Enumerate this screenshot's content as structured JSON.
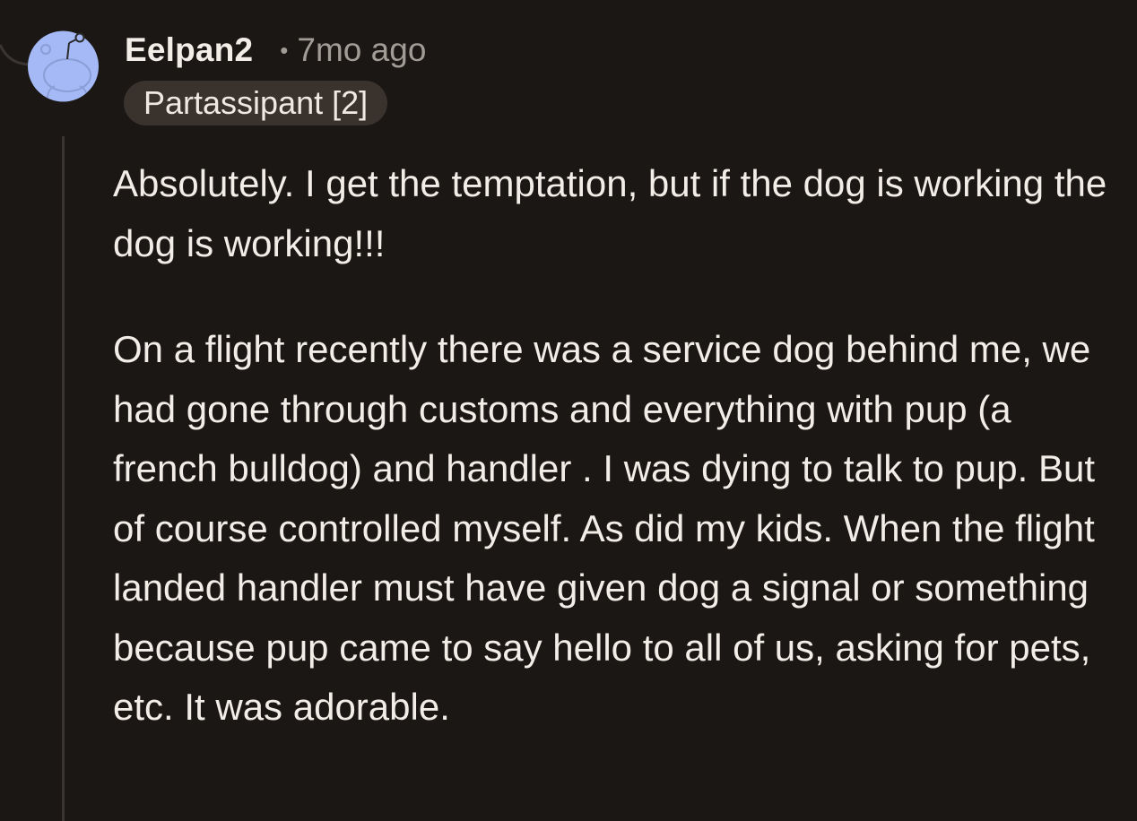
{
  "comment": {
    "username": "Eelpan2",
    "separator": "•",
    "timestamp": "7mo ago",
    "flair": "Partassipant [2]",
    "avatar_icon": "snoo-avatar-icon",
    "paragraphs": [
      "Absolutely. I get the temptation, but if the dog is working the dog is working!!!",
      "On a flight recently there was a service dog behind me, we had gone through customs and everything with pup (a french bulldog) and handler . I was dying to talk to pup. But of course controlled myself. As did my kids. When the flight landed handler must have given dog a signal or something because pup came to say hello to all of us, asking for pets, etc. It was adorable."
    ]
  },
  "colors": {
    "background": "#1a1715",
    "avatar_bg": "#a4b9f5",
    "flair_bg": "#3a322d",
    "text": "#f3ede8",
    "muted_text": "#a29c96",
    "thread_line": "#3a3532"
  }
}
